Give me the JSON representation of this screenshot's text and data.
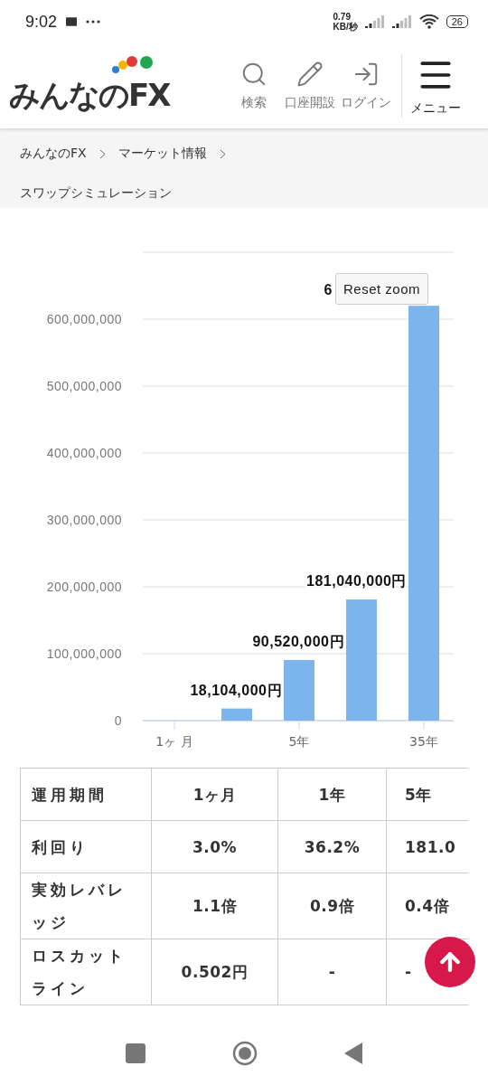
{
  "status_bar": {
    "time": "9:02",
    "network_speed": [
      "0.79",
      "KB/秒"
    ],
    "battery": "26"
  },
  "header": {
    "logo": "みんなのFX",
    "actions": [
      {
        "kind": "search",
        "label": "検索"
      },
      {
        "kind": "open_account",
        "label": "口座開設"
      },
      {
        "kind": "login",
        "label": "ログイン"
      }
    ],
    "menu_label": "メニュー"
  },
  "breadcrumb": [
    {
      "label": "みんなのFX"
    },
    {
      "label": "マーケット情報"
    },
    {
      "label": "スワップシミュレーション"
    }
  ],
  "chart": {
    "reset_zoom_label": "Reset zoom",
    "chart_data": {
      "type": "bar",
      "grid": true,
      "categories": [
        "1ヶ 月",
        null,
        "5年",
        null,
        "35年"
      ],
      "series": [
        {
          "color": "#7cb5ec",
          "values": [
            0,
            18104000,
            90520000,
            181040000,
            620000000
          ]
        }
      ],
      "ylim": [
        0,
        700000000
      ],
      "yticks": [
        {
          "value": 0,
          "label": "0"
        },
        {
          "value": 100000000,
          "label": "100,000,000"
        },
        {
          "value": 200000000,
          "label": "200,000,000"
        },
        {
          "value": 300000000,
          "label": "300,000,000"
        },
        {
          "value": 400000000,
          "label": "400,000,000"
        },
        {
          "value": 500000000,
          "label": "500,000,000"
        },
        {
          "value": 600000000,
          "label": "600,000,000"
        }
      ],
      "value_labels": [
        null,
        "18,104,000円",
        "90,520,000円",
        "181,040,000円",
        "6"
      ]
    }
  },
  "table": {
    "columns": [
      "運用期間",
      "1ヶ月",
      "1年",
      "5年"
    ],
    "rows": [
      [
        "利回り",
        "3.0%",
        "36.2%",
        "181.0"
      ],
      [
        "実効レバレッジ",
        "1.1倍",
        "0.9倍",
        "0.4倍"
      ],
      [
        "ロスカットライン",
        "0.502円",
        "-",
        "-"
      ]
    ]
  }
}
